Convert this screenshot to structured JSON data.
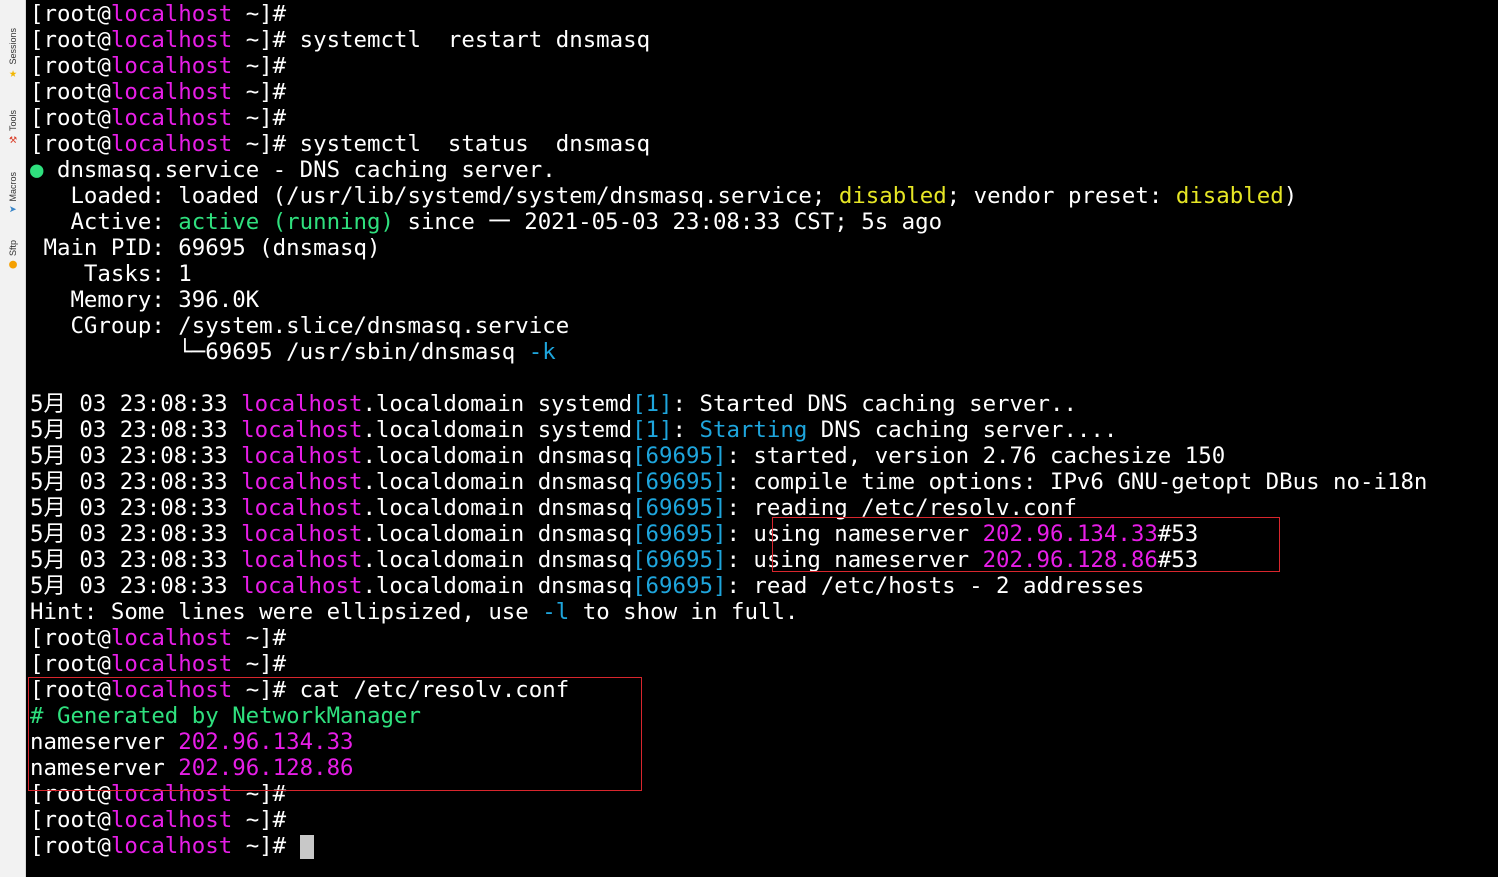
{
  "sidebar": {
    "tabs": [
      {
        "label": "Sessions",
        "icon": "sessions-icon",
        "glyph": "★",
        "color": "#f2b600"
      },
      {
        "label": "Tools",
        "icon": "tools-icon",
        "glyph": "⚒",
        "color": "#d9402b"
      },
      {
        "label": "Macros",
        "icon": "macros-icon",
        "glyph": "➤",
        "color": "#3a86c8"
      },
      {
        "label": "Sftp",
        "icon": "sftp-icon",
        "glyph": "●",
        "color": "#f5a000"
      }
    ]
  },
  "colors": {
    "background": "#000000",
    "text": "#ffffff",
    "magenta": "#e71ee7",
    "cyan": "#1ea5dc",
    "green": "#2fe07e",
    "yellow": "#e6e625",
    "highlight_box": "#d8262d"
  },
  "terminal": {
    "lines": [
      [
        {
          "t": "[root@"
        },
        {
          "t": "localhost",
          "c": "magenta"
        },
        {
          "t": " ~]#"
        }
      ],
      [
        {
          "t": "[root@"
        },
        {
          "t": "localhost",
          "c": "magenta"
        },
        {
          "t": " ~]# systemctl  restart dnsmasq"
        }
      ],
      [
        {
          "t": "[root@"
        },
        {
          "t": "localhost",
          "c": "magenta"
        },
        {
          "t": " ~]#"
        }
      ],
      [
        {
          "t": "[root@"
        },
        {
          "t": "localhost",
          "c": "magenta"
        },
        {
          "t": " ~]#"
        }
      ],
      [
        {
          "t": "[root@"
        },
        {
          "t": "localhost",
          "c": "magenta"
        },
        {
          "t": " ~]#"
        }
      ],
      [
        {
          "t": "[root@"
        },
        {
          "t": "localhost",
          "c": "magenta"
        },
        {
          "t": " ~]# systemctl  status  dnsmasq"
        }
      ],
      [
        {
          "t": "●",
          "c": "green"
        },
        {
          "t": " dnsmasq.service - DNS caching server."
        }
      ],
      [
        {
          "t": "   Loaded: loaded (/usr/lib/systemd/system/dnsmasq.service; "
        },
        {
          "t": "disabled",
          "c": "yellow"
        },
        {
          "t": "; vendor preset: "
        },
        {
          "t": "disabled",
          "c": "yellow"
        },
        {
          "t": ")"
        }
      ],
      [
        {
          "t": "   Active: "
        },
        {
          "t": "active (running)",
          "c": "green"
        },
        {
          "t": " since 一 2021-05-03 23:08:33 CST; 5s ago"
        }
      ],
      [
        {
          "t": " Main PID: 69695 (dnsmasq)"
        }
      ],
      [
        {
          "t": "    Tasks: 1"
        }
      ],
      [
        {
          "t": "   Memory: 396.0K"
        }
      ],
      [
        {
          "t": "   CGroup: /system.slice/dnsmasq.service"
        }
      ],
      [
        {
          "t": "           └─69695 /usr/sbin/dnsmasq "
        },
        {
          "t": "-k",
          "c": "cyan"
        }
      ],
      [],
      [
        {
          "t": "5月 03 23:08:33 "
        },
        {
          "t": "localhost",
          "c": "magenta"
        },
        {
          "t": ".localdomain systemd"
        },
        {
          "t": "[1]",
          "c": "cyan"
        },
        {
          "t": ": Started DNS caching server.."
        }
      ],
      [
        {
          "t": "5月 03 23:08:33 "
        },
        {
          "t": "localhost",
          "c": "magenta"
        },
        {
          "t": ".localdomain systemd"
        },
        {
          "t": "[1]",
          "c": "cyan"
        },
        {
          "t": ": "
        },
        {
          "t": "Starting",
          "c": "cyan"
        },
        {
          "t": " DNS caching server...."
        }
      ],
      [
        {
          "t": "5月 03 23:08:33 "
        },
        {
          "t": "localhost",
          "c": "magenta"
        },
        {
          "t": ".localdomain dnsmasq"
        },
        {
          "t": "[69695]",
          "c": "cyan"
        },
        {
          "t": ": started, version 2.76 cachesize 150"
        }
      ],
      [
        {
          "t": "5月 03 23:08:33 "
        },
        {
          "t": "localhost",
          "c": "magenta"
        },
        {
          "t": ".localdomain dnsmasq"
        },
        {
          "t": "[69695]",
          "c": "cyan"
        },
        {
          "t": ": compile time options: IPv6 GNU-getopt DBus no-i18n"
        }
      ],
      [
        {
          "t": "5月 03 23:08:33 "
        },
        {
          "t": "localhost",
          "c": "magenta"
        },
        {
          "t": ".localdomain dnsmasq"
        },
        {
          "t": "[69695]",
          "c": "cyan"
        },
        {
          "t": ": reading /etc/resolv.conf"
        }
      ],
      [
        {
          "t": "5月 03 23:08:33 "
        },
        {
          "t": "localhost",
          "c": "magenta"
        },
        {
          "t": ".localdomain dnsmasq"
        },
        {
          "t": "[69695]",
          "c": "cyan"
        },
        {
          "t": ": using nameserver "
        },
        {
          "t": "202.96.134.33",
          "c": "magenta"
        },
        {
          "t": "#53"
        }
      ],
      [
        {
          "t": "5月 03 23:08:33 "
        },
        {
          "t": "localhost",
          "c": "magenta"
        },
        {
          "t": ".localdomain dnsmasq"
        },
        {
          "t": "[69695]",
          "c": "cyan"
        },
        {
          "t": ": using nameserver "
        },
        {
          "t": "202.96.128.86",
          "c": "magenta"
        },
        {
          "t": "#53"
        }
      ],
      [
        {
          "t": "5月 03 23:08:33 "
        },
        {
          "t": "localhost",
          "c": "magenta"
        },
        {
          "t": ".localdomain dnsmasq"
        },
        {
          "t": "[69695]",
          "c": "cyan"
        },
        {
          "t": ": read /etc/hosts - 2 addresses"
        }
      ],
      [
        {
          "t": "Hint: Some lines were ellipsized, use "
        },
        {
          "t": "-l",
          "c": "cyan"
        },
        {
          "t": " to show in full."
        }
      ],
      [
        {
          "t": "[root@"
        },
        {
          "t": "localhost",
          "c": "magenta"
        },
        {
          "t": " ~]#"
        }
      ],
      [
        {
          "t": "[root@"
        },
        {
          "t": "localhost",
          "c": "magenta"
        },
        {
          "t": " ~]#"
        }
      ],
      [
        {
          "t": "[root@"
        },
        {
          "t": "localhost",
          "c": "magenta"
        },
        {
          "t": " ~]# cat /etc/resolv.conf"
        }
      ],
      [
        {
          "t": "# Generated by NetworkManager",
          "c": "green"
        }
      ],
      [
        {
          "t": "nameserver "
        },
        {
          "t": "202.96.134.33",
          "c": "magenta"
        }
      ],
      [
        {
          "t": "nameserver "
        },
        {
          "t": "202.96.128.86",
          "c": "magenta"
        }
      ],
      [
        {
          "t": "[root@"
        },
        {
          "t": "localhost",
          "c": "magenta"
        },
        {
          "t": " ~]#"
        }
      ],
      [
        {
          "t": "[root@"
        },
        {
          "t": "localhost",
          "c": "magenta"
        },
        {
          "t": " ~]#"
        }
      ],
      [
        {
          "t": "[root@"
        },
        {
          "t": "localhost",
          "c": "magenta"
        },
        {
          "t": " ~]# "
        },
        {
          "cursor": true
        }
      ]
    ]
  }
}
